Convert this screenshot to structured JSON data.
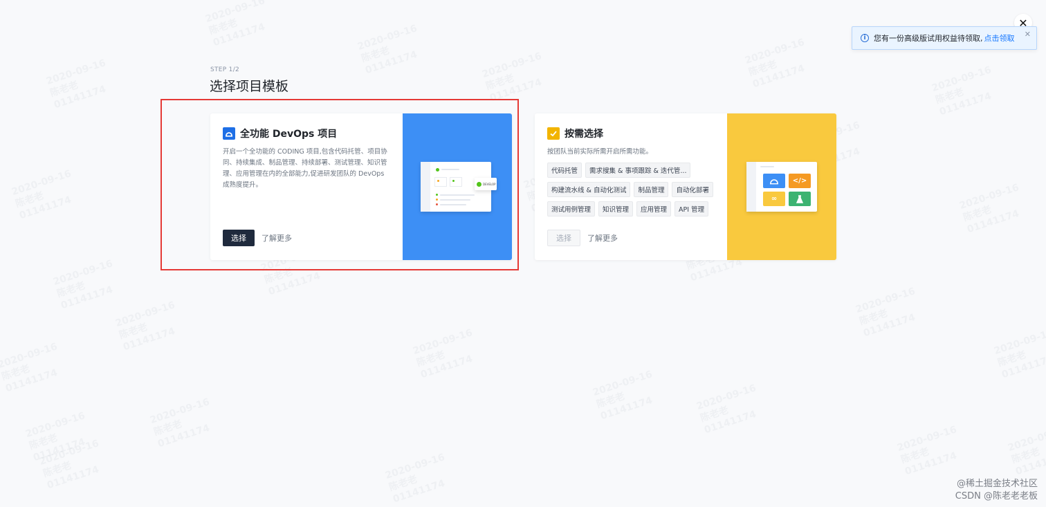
{
  "close_symbol": "✕",
  "notice": {
    "icon": "info-icon",
    "text": "您有一份高级版试用权益待领取,",
    "link": "点击领取",
    "close_symbol": "✕"
  },
  "step_label": "STEP 1/2",
  "page_title": "选择项目模板",
  "cards": {
    "full": {
      "icon": "coding-logo-icon",
      "title": "全功能 DevOps 项目",
      "description": "开启一个全功能的 CODING 项目,包含代码托管、项目协同、持续集成、制品管理、持续部署、测试管理、知识管理、应用管理在内的全部能力,促进研发团队的 DevOps 成熟度提升。",
      "select_label": "选择",
      "learn_more_label": "了解更多",
      "illustration_badge": "DEVELOP",
      "accent_color": "#3d8ff5"
    },
    "custom": {
      "icon": "check-icon",
      "title": "按需选择",
      "description": "按团队当前实际所需开启所需功能。",
      "tags": [
        "代码托管",
        "需求搜集 & 事项跟踪 & 迭代管...",
        "构建流水线 & 自动化测试",
        "制品管理",
        "自动化部署",
        "测试用例管理",
        "知识管理",
        "应用管理",
        "API 管理"
      ],
      "select_label": "选择",
      "learn_more_label": "了解更多",
      "accent_color": "#f9c93e"
    }
  },
  "watermark": {
    "date": "2020-09-16",
    "name": "陈老老",
    "id": "01141174"
  },
  "brand": {
    "line1": "@稀土掘金技术社区",
    "line2": "CSDN @陈老老老板"
  }
}
